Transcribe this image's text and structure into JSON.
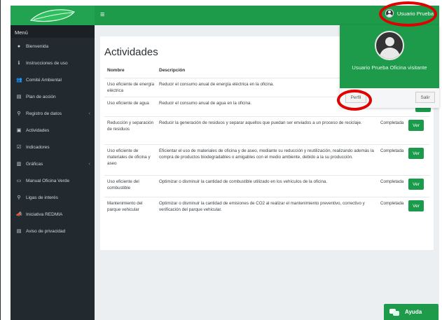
{
  "topbar": {
    "menu_icon": "hamburger-icon",
    "user_name": "Usuario Prueba"
  },
  "sidebar": {
    "heading": "Menú",
    "items": [
      {
        "label": "Bienvenida",
        "icon": "chat-bubble-icon",
        "glyph": "●",
        "caret": false
      },
      {
        "label": "Instrucciones de uso",
        "icon": "info-icon",
        "glyph": "ℹ",
        "caret": false
      },
      {
        "label": "Comité Ambiental",
        "icon": "users-icon",
        "glyph": "👥",
        "caret": false
      },
      {
        "label": "Plan de acción",
        "icon": "document-icon",
        "glyph": "▤",
        "caret": false
      },
      {
        "label": "Registro de datos",
        "icon": "binoculars-icon",
        "glyph": "⚲",
        "caret": true
      },
      {
        "label": "Actividades",
        "icon": "briefcase-icon",
        "glyph": "▣",
        "caret": false
      },
      {
        "label": "Indicadores",
        "icon": "checkbox-icon",
        "glyph": "☑",
        "caret": false
      },
      {
        "label": "Gráficas",
        "icon": "bar-chart-icon",
        "glyph": "▥",
        "caret": true
      },
      {
        "label": "Manual Oficina Verde",
        "icon": "book-icon",
        "glyph": "▭",
        "caret": false
      },
      {
        "label": "Ligas de interés",
        "icon": "pin-icon",
        "glyph": "⚲",
        "caret": false
      },
      {
        "label": "Iniciativa REDMIA",
        "icon": "bullhorn-icon",
        "glyph": "📣",
        "caret": false
      },
      {
        "label": "Aviso de privacidad",
        "icon": "file-icon",
        "glyph": "▤",
        "caret": false
      }
    ]
  },
  "card": {
    "title": "Actividades",
    "headers": {
      "nombre": "Nombre",
      "descripcion": "Descripción"
    },
    "ver_label": "Ver",
    "rows": [
      {
        "nombre": "Uso eficiente de energía eléctrica",
        "descripcion": "Reducir el consumo anual de energía eléctrica en la oficina.",
        "estado": "",
        "ver": false
      },
      {
        "nombre": "Uso eficiente de agua",
        "descripcion": "Reducir el consumo anual de agua en la oficina.",
        "estado": "",
        "ver": false
      },
      {
        "nombre": "Reducción y separación de residuos",
        "descripcion": "Reducir la generación de residuos y separar aquellos que puedan ser enviados a un proceso de reciclaje.",
        "estado": "Completada",
        "ver": true
      },
      {
        "nombre": "Uso eficiente de materiales de oficina y aseo",
        "descripcion": "Eficientar el uso de materiales de oficina y de aseo, mediante su reducción y reutilización, realizando además la compra de productos biodegradables o amigables con el medio ambiente, debido a la su producción.",
        "estado": "Completada",
        "ver": true
      },
      {
        "nombre": "Uso eficiente del combustible",
        "descripcion": "Optimizar o disminuir la cantidad de combustible utilizado en los vehículos de la oficina.",
        "estado": "Completada",
        "ver": true
      },
      {
        "nombre": "Mantenimiento del parque vehicular",
        "descripcion": "Optimizar o disminuir la cantidad de emisiones de CO2 al realizar el mantenimiento preventivo, correctivo y verificación del parque vehicular.",
        "estado": "Completada",
        "ver": true
      }
    ]
  },
  "dropdown": {
    "user_full": "Usuario Prueba Oficina visitante",
    "perfil_label": "Perfil",
    "salir_label": "Salir"
  },
  "help": {
    "label": "Ayuda"
  },
  "colors": {
    "brand_green": "#1d9a4a",
    "sidebar_bg": "#22292f",
    "highlight_red": "#e00000"
  }
}
